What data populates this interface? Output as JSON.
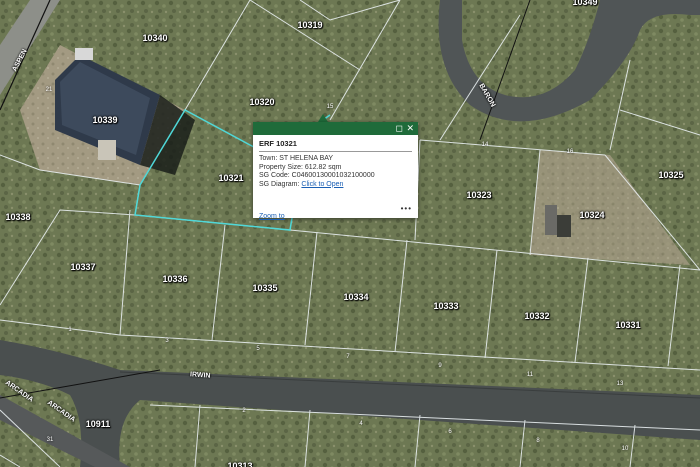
{
  "parcels": {
    "p10349": "10349",
    "p10319": "10319",
    "p10340": "10340",
    "p10320": "10320",
    "p10339": "10339",
    "p10321": "10321",
    "p10338": "10338",
    "p10337": "10337",
    "p10336": "10336",
    "p10335": "10335",
    "p10334": "10334",
    "p10333": "10333",
    "p10332": "10332",
    "p10331": "10331",
    "p10323": "10323",
    "p10324": "10324",
    "p10325": "10325",
    "p10911": "10911",
    "p10313": "10313"
  },
  "streets": {
    "aspen": "ASPEN",
    "baron": "BARON",
    "irwin": "IRWIN",
    "arcadia1": "ARCADIA",
    "arcadia2": "ARCADIA"
  },
  "street_numbers": [
    "1",
    "3",
    "5",
    "7",
    "9",
    "11",
    "13",
    "14",
    "16",
    "2",
    "4",
    "6",
    "8",
    "10",
    "15",
    "21",
    "31"
  ],
  "popup": {
    "title": "ERF 10321",
    "town": "Town:  ST HELENA BAY",
    "size": "Property Size: 612.82 sqm",
    "sg_code": "SG Code: C04600130001032100000",
    "sg_diagram_label": "SG Diagram: ",
    "sg_diagram_link": "Click to Open",
    "zoom_to": "Zoom to",
    "more": "•••",
    "maximize": "◻",
    "close": "✕"
  },
  "colors": {
    "vegetation": "#6f7a55",
    "road": "#4a4f4f",
    "parcel_line": "#e8eef0",
    "selected_line": "#4fd8d8",
    "popup_header": "#1f6b3a"
  }
}
